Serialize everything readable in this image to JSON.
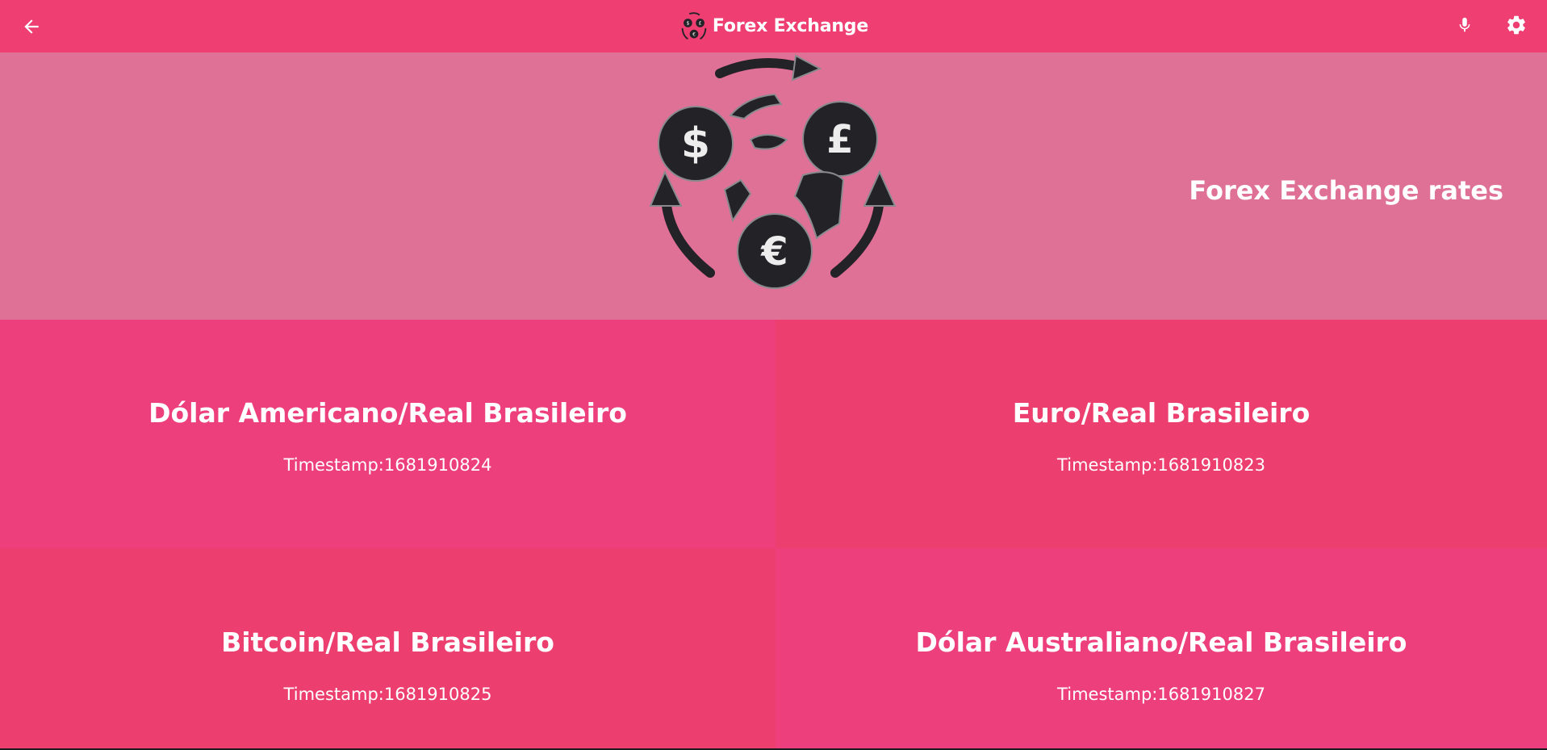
{
  "colors": {
    "appbar_bg": "#ee3e72",
    "hero_bg": "#df7096",
    "tile_pink": "#ee3f7d",
    "tile_red": "#ec3e6f",
    "text": "#ffffff",
    "logo_dark": "#232227"
  },
  "appbar": {
    "back_icon": "arrow-left-icon",
    "title": "Forex Exchange",
    "mic_icon": "microphone-icon",
    "settings_icon": "gear-icon"
  },
  "hero": {
    "logo_icon": "currency-exchange-globe-icon",
    "heading": "Forex Exchange rates"
  },
  "tiles": [
    {
      "pair": "Dólar Americano/Real Brasileiro",
      "timestamp": "Timestamp:1681910824",
      "color": "#ee3f7d"
    },
    {
      "pair": "Euro/Real Brasileiro",
      "timestamp": "Timestamp:1681910823",
      "color": "#ec3e6f"
    },
    {
      "pair": "Bitcoin/Real Brasileiro",
      "timestamp": "Timestamp:1681910825",
      "color": "#ec3e6f"
    },
    {
      "pair": "Dólar Australiano/Real Brasileiro",
      "timestamp": "Timestamp:1681910827",
      "color": "#ee3f7d"
    }
  ]
}
